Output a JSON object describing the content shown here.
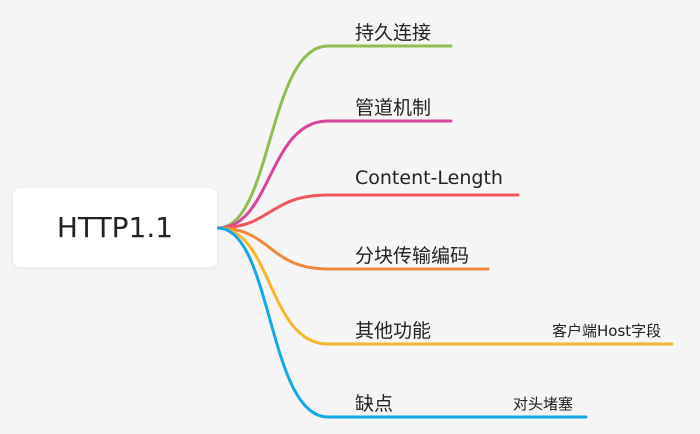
{
  "root": {
    "label": "HTTP1.1"
  },
  "branches": [
    {
      "label": "持久连接",
      "color": "#8bbf4f"
    },
    {
      "label": "管道机制",
      "color": "#d8449b"
    },
    {
      "label": "Content-Length",
      "color": "#f0565a"
    },
    {
      "label": "分块传输编码",
      "color": "#f2883a"
    },
    {
      "label": "其他功能",
      "color": "#f7b52b",
      "child": {
        "label": "客户端Host字段"
      }
    },
    {
      "label": "缺点",
      "color": "#12a9e8",
      "child": {
        "label": "对头堵塞"
      }
    }
  ]
}
